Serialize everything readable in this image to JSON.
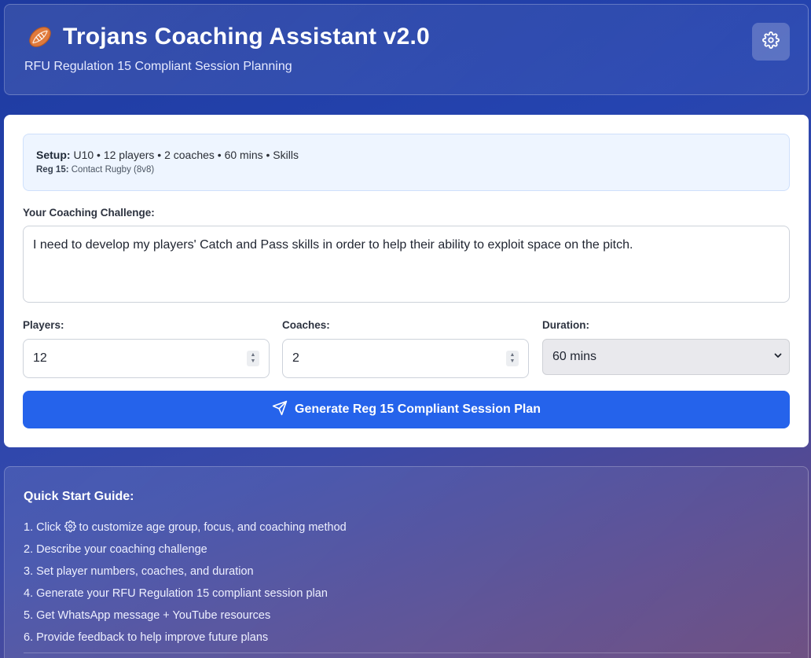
{
  "header": {
    "title": "Trojans Coaching Assistant v2.0",
    "subtitle": "RFU Regulation 15 Compliant Session Planning",
    "logo_icon": "rugby-ball-icon",
    "settings_icon": "gear-icon"
  },
  "setup": {
    "setup_label": "Setup:",
    "setup_text": "U10 • 12 players • 2 coaches • 60 mins • Skills",
    "reg_label": "Reg 15:",
    "reg_text": "Contact Rugby (8v8)"
  },
  "form": {
    "challenge_label": "Your Coaching Challenge:",
    "challenge_value": "I need to develop my players' Catch and Pass skills in order to help their ability to exploit space on the pitch.",
    "players_label": "Players:",
    "players_value": "12",
    "coaches_label": "Coaches:",
    "coaches_value": "2",
    "duration_label": "Duration:",
    "duration_value": "60 mins",
    "generate_label": "Generate Reg 15 Compliant Session Plan",
    "generate_icon": "send-icon"
  },
  "guide": {
    "title": "Quick Start Guide:",
    "step1_before": "1. Click",
    "step1_after": "to customize age group, focus, and coaching method",
    "step2": "2. Describe your coaching challenge",
    "step3": "3. Set player numbers, coaches, and duration",
    "step4": "4. Generate your RFU Regulation 15 compliant session plan",
    "step5": "5. Get WhatsApp message + YouTube resources",
    "step6": "6. Provide feedback to help improve future plans"
  },
  "colors": {
    "primary_button": "#2563eb",
    "card_background": "#ffffff",
    "setup_background": "#eef5ff"
  }
}
